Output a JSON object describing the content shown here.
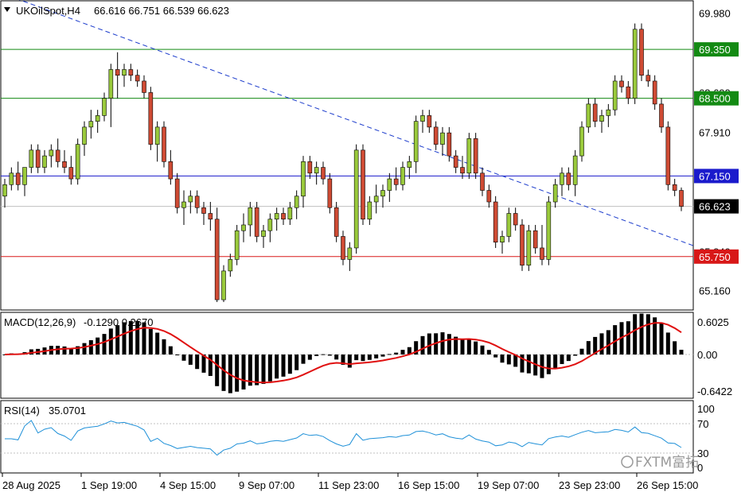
{
  "main_panel": {
    "symbol_title": "UKOilSpot,H4",
    "ohlc": "66.616 66.751 66.539 66.623",
    "price_labels": [
      "69.980",
      "68.600",
      "67.910",
      "67.220",
      "65.840",
      "65.160"
    ],
    "level_tags": [
      {
        "text": "69.350",
        "value": 69.35,
        "color": "#138a13"
      },
      {
        "text": "68.500",
        "value": 68.5,
        "color": "#138a13"
      },
      {
        "text": "67.150",
        "value": 67.15,
        "color": "#1a1acc"
      },
      {
        "text": "66.623",
        "value": 66.623,
        "color": "#000000"
      },
      {
        "text": "65.750",
        "value": 65.75,
        "color": "#d81818"
      }
    ],
    "colors": {
      "bull": "#9aca3c",
      "bear": "#cf4b34",
      "wick": "#000000",
      "trend": "#1c3ccc"
    }
  },
  "macd_panel": {
    "title": "MACD(12,26,9)",
    "values_text": "-0.1290 0.2670",
    "labels": [
      "0.6025",
      "0.00",
      "-0.6422"
    ],
    "colors": {
      "hist": "#000000",
      "signal": "#e01010"
    }
  },
  "rsi_panel": {
    "title": "RSI(14)",
    "value_text": "35.0701",
    "labels": [
      "100",
      "70",
      "30",
      "0"
    ],
    "colors": {
      "line": "#1e90d8"
    }
  },
  "time_axis": [
    "28 Aug 2025",
    "1 Sep 19:00",
    "4 Sep 15:00",
    "9 Sep 07:00",
    "11 Sep 23:00",
    "16 Sep 15:00",
    "19 Sep 07:00",
    "23 Sep 23:00",
    "26 Sep 15:00"
  ],
  "watermark": "FXTM富拓",
  "chart_data": {
    "type": "candlestick",
    "title": "UKOilSpot,H4",
    "ylim": [
      64.96,
      70.07
    ],
    "horizontal_levels": [
      69.35,
      68.5,
      67.15,
      65.75
    ],
    "trendline": {
      "from_price": 70.33,
      "to_price": 65.94
    },
    "candles": [
      [
        66.8,
        67.1,
        66.6,
        67.0
      ],
      [
        67.0,
        67.3,
        66.9,
        67.2
      ],
      [
        67.2,
        67.4,
        66.9,
        67.0
      ],
      [
        67.0,
        67.3,
        66.8,
        67.3
      ],
      [
        67.3,
        67.7,
        67.2,
        67.6
      ],
      [
        67.6,
        67.7,
        67.2,
        67.3
      ],
      [
        67.3,
        67.6,
        67.2,
        67.5
      ],
      [
        67.5,
        67.7,
        67.3,
        67.6
      ],
      [
        67.6,
        67.8,
        67.3,
        67.4
      ],
      [
        67.4,
        67.6,
        67.2,
        67.3
      ],
      [
        67.3,
        67.5,
        67.0,
        67.1
      ],
      [
        67.1,
        67.8,
        67.0,
        67.7
      ],
      [
        67.7,
        68.1,
        67.5,
        68.0
      ],
      [
        68.0,
        68.3,
        67.8,
        68.1
      ],
      [
        68.1,
        68.3,
        67.9,
        68.2
      ],
      [
        68.2,
        68.6,
        68.1,
        68.5
      ],
      [
        68.5,
        69.1,
        68.0,
        69.0
      ],
      [
        69.0,
        69.3,
        68.5,
        68.9
      ],
      [
        68.9,
        69.1,
        68.7,
        69.0
      ],
      [
        69.0,
        69.1,
        68.8,
        68.9
      ],
      [
        68.9,
        69.0,
        68.7,
        68.8
      ],
      [
        68.8,
        68.9,
        68.5,
        68.6
      ],
      [
        68.6,
        68.7,
        67.6,
        67.7
      ],
      [
        67.7,
        68.1,
        67.4,
        68.0
      ],
      [
        68.0,
        68.1,
        67.3,
        67.4
      ],
      [
        67.4,
        67.6,
        67.0,
        67.1
      ],
      [
        67.1,
        67.2,
        66.5,
        66.6
      ],
      [
        66.6,
        66.9,
        66.3,
        66.7
      ],
      [
        66.7,
        66.9,
        66.5,
        66.8
      ],
      [
        66.8,
        66.9,
        66.5,
        66.6
      ],
      [
        66.6,
        66.7,
        66.3,
        66.5
      ],
      [
        66.5,
        66.7,
        66.2,
        66.4
      ],
      [
        66.4,
        66.6,
        64.96,
        65.0
      ],
      [
        65.0,
        65.6,
        64.96,
        65.5
      ],
      [
        65.5,
        65.8,
        65.4,
        65.7
      ],
      [
        65.7,
        66.3,
        65.6,
        66.2
      ],
      [
        66.2,
        66.5,
        66.0,
        66.3
      ],
      [
        66.3,
        66.7,
        66.1,
        66.6
      ],
      [
        66.6,
        66.7,
        66.0,
        66.1
      ],
      [
        66.1,
        66.3,
        65.9,
        66.2
      ],
      [
        66.2,
        66.5,
        66.0,
        66.4
      ],
      [
        66.4,
        66.6,
        66.2,
        66.5
      ],
      [
        66.5,
        66.6,
        66.3,
        66.4
      ],
      [
        66.4,
        66.7,
        66.3,
        66.6
      ],
      [
        66.6,
        66.9,
        66.4,
        66.8
      ],
      [
        66.8,
        67.5,
        66.6,
        67.4
      ],
      [
        67.4,
        67.5,
        67.1,
        67.2
      ],
      [
        67.2,
        67.4,
        67.0,
        67.3
      ],
      [
        67.3,
        67.4,
        67.0,
        67.1
      ],
      [
        67.1,
        67.2,
        66.5,
        66.6
      ],
      [
        66.6,
        66.7,
        66.0,
        66.1
      ],
      [
        66.1,
        66.2,
        65.6,
        65.7
      ],
      [
        65.7,
        66.0,
        65.5,
        65.9
      ],
      [
        65.9,
        67.7,
        65.8,
        67.6
      ],
      [
        67.6,
        67.7,
        66.3,
        66.4
      ],
      [
        66.4,
        66.8,
        66.3,
        66.7
      ],
      [
        66.7,
        67.0,
        66.5,
        66.8
      ],
      [
        66.8,
        67.0,
        66.6,
        66.9
      ],
      [
        66.9,
        67.2,
        66.7,
        67.1
      ],
      [
        67.1,
        67.3,
        66.9,
        67.0
      ],
      [
        67.0,
        67.4,
        66.9,
        67.3
      ],
      [
        67.3,
        67.5,
        67.1,
        67.4
      ],
      [
        67.4,
        68.2,
        67.2,
        68.1
      ],
      [
        68.1,
        68.3,
        67.9,
        68.2
      ],
      [
        68.2,
        68.3,
        67.9,
        68.0
      ],
      [
        68.0,
        68.1,
        67.6,
        67.7
      ],
      [
        67.7,
        68.0,
        67.5,
        67.9
      ],
      [
        67.9,
        68.0,
        67.4,
        67.5
      ],
      [
        67.5,
        67.6,
        67.2,
        67.3
      ],
      [
        67.3,
        67.5,
        67.1,
        67.2
      ],
      [
        67.2,
        67.9,
        67.1,
        67.8
      ],
      [
        67.8,
        67.9,
        67.1,
        67.2
      ],
      [
        67.2,
        67.3,
        66.8,
        66.9
      ],
      [
        66.9,
        67.0,
        66.6,
        66.7
      ],
      [
        66.7,
        66.8,
        65.9,
        66.0
      ],
      [
        66.0,
        66.2,
        65.8,
        66.1
      ],
      [
        66.1,
        66.6,
        66.0,
        66.5
      ],
      [
        66.5,
        66.6,
        66.2,
        66.3
      ],
      [
        66.3,
        66.4,
        65.5,
        65.6
      ],
      [
        65.6,
        66.3,
        65.5,
        66.2
      ],
      [
        66.2,
        66.3,
        65.8,
        65.9
      ],
      [
        65.9,
        66.3,
        65.6,
        65.7
      ],
      [
        65.7,
        66.8,
        65.6,
        66.7
      ],
      [
        66.7,
        67.1,
        66.6,
        67.0
      ],
      [
        67.0,
        67.3,
        66.8,
        67.2
      ],
      [
        67.2,
        67.3,
        66.9,
        67.0
      ],
      [
        67.0,
        67.6,
        66.8,
        67.5
      ],
      [
        67.5,
        68.1,
        67.4,
        68.0
      ],
      [
        68.0,
        68.5,
        67.9,
        68.4
      ],
      [
        68.4,
        68.5,
        68.0,
        68.1
      ],
      [
        68.1,
        68.3,
        67.9,
        68.2
      ],
      [
        68.2,
        68.4,
        68.0,
        68.3
      ],
      [
        68.3,
        68.9,
        68.2,
        68.8
      ],
      [
        68.8,
        68.9,
        68.6,
        68.7
      ],
      [
        68.7,
        68.8,
        68.4,
        68.5
      ],
      [
        68.5,
        69.8,
        68.4,
        69.7
      ],
      [
        69.7,
        69.8,
        68.8,
        68.9
      ],
      [
        68.9,
        69.0,
        68.7,
        68.8
      ],
      [
        68.8,
        68.9,
        68.3,
        68.4
      ],
      [
        68.4,
        68.5,
        67.9,
        68.0
      ],
      [
        68.0,
        68.1,
        66.9,
        67.0
      ],
      [
        67.0,
        67.1,
        66.8,
        66.9
      ],
      [
        66.9,
        66.95,
        66.539,
        66.623
      ]
    ],
    "macd": {
      "hist_first": 0.08,
      "hist_peak_sep1": 0.55,
      "hist_trough_sep4": -0.64,
      "hist_peak_sep10": 0.2,
      "hist_peak_sep16": 0.38,
      "hist_trough_sep19": -0.45,
      "hist_peak_sep25": 0.6,
      "hist_last": -0.129,
      "signal_last": 0.267
    },
    "rsi": {
      "last": 35.0701,
      "range": [
        0,
        100
      ],
      "levels": [
        70,
        30
      ]
    }
  }
}
